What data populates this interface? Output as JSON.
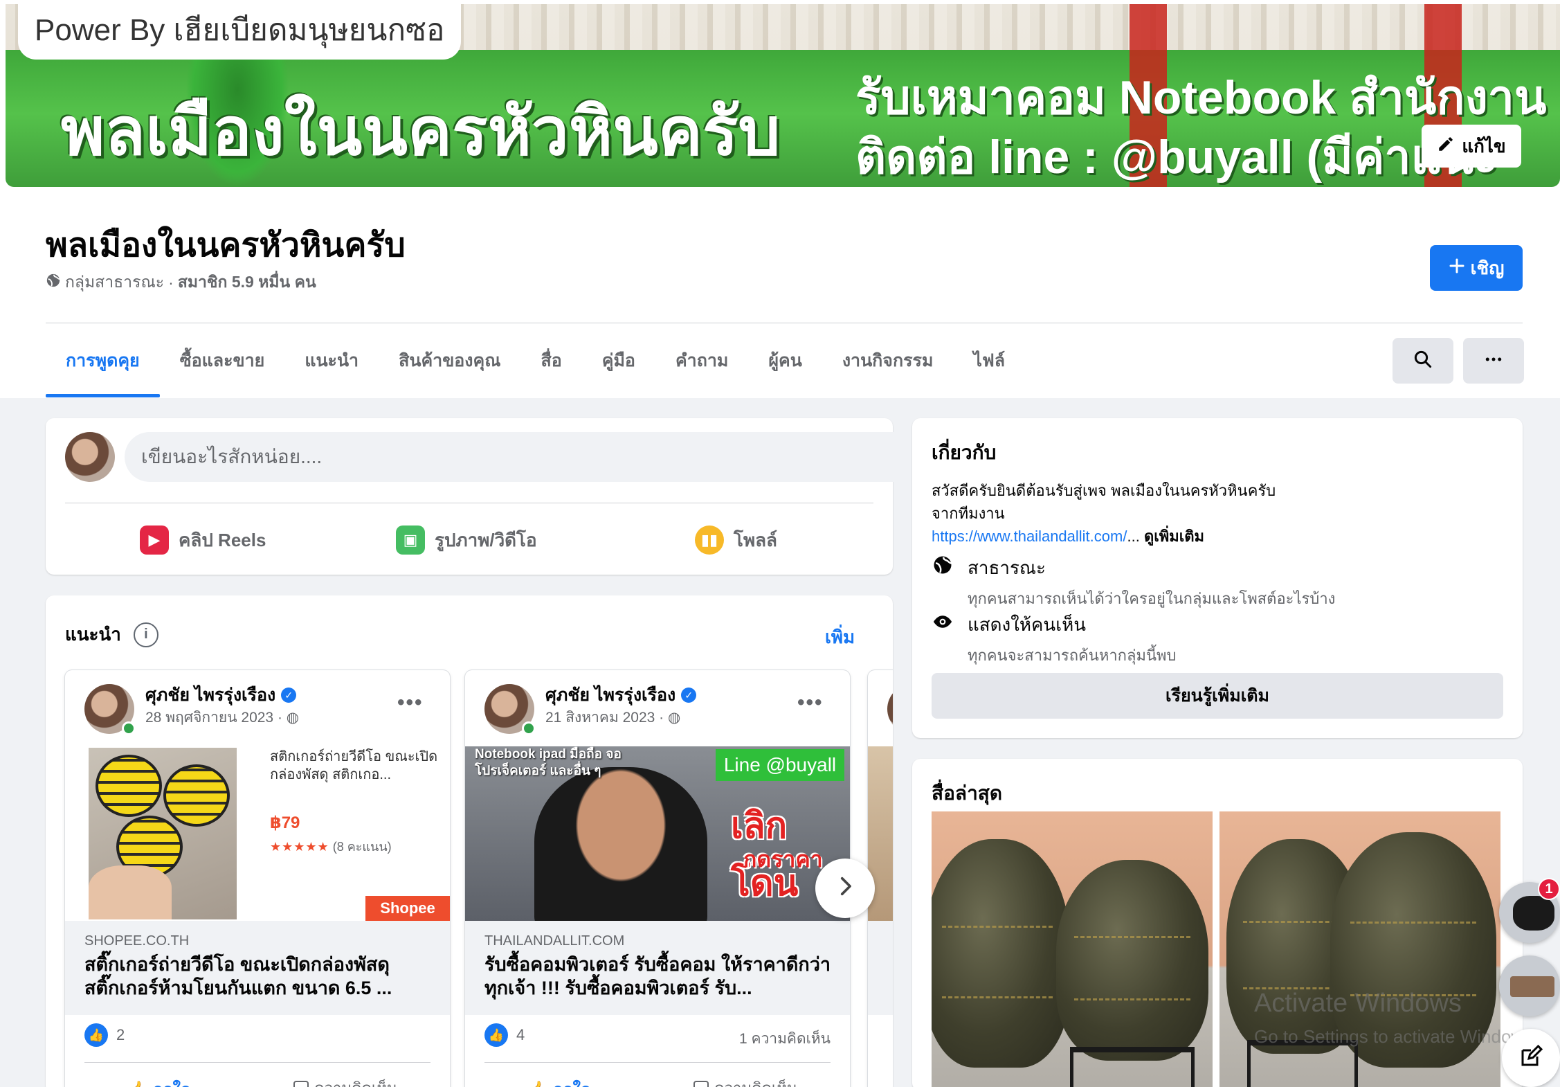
{
  "cover": {
    "power_text": "Power By เฮียเบียดมนุษยนกซอ",
    "big_text": "พลเมืองในนครหัวหินครับ",
    "ad_line1": "รับเหมาคอม Notebook สำนักงาน",
    "ad_line2": "ติดต่อ line : @buyall (มีค่าแนะ",
    "edit_label": "แก้ไข"
  },
  "group": {
    "name": "พลเมืองในนครหัวหินครับ",
    "privacy": "กลุ่มสาธารณะ",
    "dot": "·",
    "members": "สมาชิก 5.9 หมื่น คน",
    "invite_label": "เชิญ"
  },
  "tabs": [
    {
      "label": "การพูดคุย",
      "active": true
    },
    {
      "label": "ซื้อและขาย"
    },
    {
      "label": "แนะนำ"
    },
    {
      "label": "สินค้าของคุณ"
    },
    {
      "label": "สื่อ"
    },
    {
      "label": "คู่มือ"
    },
    {
      "label": "คำถาม"
    },
    {
      "label": "ผู้คน"
    },
    {
      "label": "งานกิจกรรม"
    },
    {
      "label": "ไฟล์"
    }
  ],
  "composer": {
    "placeholder": "เขียนอะไรสักหน่อย....",
    "actions": [
      {
        "label": "คลิป Reels",
        "icon": "reels-icon",
        "color": "#e42645"
      },
      {
        "label": "รูปภาพ/วิดีโอ",
        "icon": "photo-icon",
        "color": "#45bd62"
      },
      {
        "label": "โพลล์",
        "icon": "poll-icon",
        "color": "#f7b928"
      }
    ]
  },
  "featured": {
    "title": "แนะนำ",
    "more_label": "เพิ่ม",
    "posts": [
      {
        "author": "ศุภชัย ไพรรุ่งเรือง",
        "date": "28 พฤศจิกายน 2023 ·",
        "shop_desc": "สติกเกอร์ถ่ายวีดีโอ ขณะเปิดกล่องพัสดุ สติกเกอ...",
        "shop_price": "฿79",
        "shop_stars": "★★★★★",
        "shop_reviews": "(8 คะแนน)",
        "shop_tag": "Shopee",
        "domain": "SHOPEE.CO.TH",
        "link_title": "สติ๊กเกอร์ถ่ายวีดีโอ ขณะเปิดกล่องพัสดุ สติ๊กเกอร์ห้ามโยนกันแตก ขนาด 6.5 ...",
        "likes": "2",
        "comments": "",
        "like_action": "ถูกใจ",
        "comment_action": "ความคิดเห็น"
      },
      {
        "author": "ศุภชัย ไพรรุ่งเรือง",
        "date": "21 สิงหาคม 2023 ·",
        "video_caption": "Notebook ipad มือถือ จอ โปรเจ็คเตอร์ และอื่น ๆ",
        "line_badge": "Line @buyall",
        "red_text": "เลิกโดน",
        "red_sub": "กดราคา",
        "domain": "THAILANDALLIT.COM",
        "link_title": "รับซื้อคอมพิวเตอร์ รับซื้อคอม ให้ราคาดีกว่าทุกเจ้า !!! รับซื้อคอมพิวเตอร์ รับ...",
        "likes": "4",
        "comments": "1 ความคิดเห็น",
        "like_action": "ถูกใจ",
        "comment_action": "ความคิดเห็น"
      }
    ]
  },
  "about": {
    "title": "เกี่ยวกับ",
    "desc_line1": "สวัสดีครับยินดีต้อนรับสู่เพจ พลเมืองในนครหัวหินครับ",
    "desc_line2": "จากทีมงาน",
    "link": "https://www.thailandallit.com/",
    "ellipsis": "...",
    "see_more": "ดูเพิ่มเติม",
    "public_title": "สาธารณะ",
    "public_desc": "ทุกคนสามารถเห็นได้ว่าใครอยู่ในกลุ่มและโพสต์อะไรบ้าง",
    "visible_title": "แสดงให้คนเห็น",
    "visible_desc": "ทุกคนจะสามารถค้นหากลุ่มนี้พบ",
    "learn_more": "เรียนรู้เพิ่มเติม"
  },
  "recent_media": {
    "title": "สื่อล่าสุด"
  },
  "watermark": {
    "line1": "Activate Windows",
    "line2": "Go to Settings to activate Windows."
  },
  "chat": {
    "badge": "1"
  },
  "colors": {
    "accent": "#1877f2",
    "online": "#31a24c",
    "shopee": "#ee4d2d"
  }
}
